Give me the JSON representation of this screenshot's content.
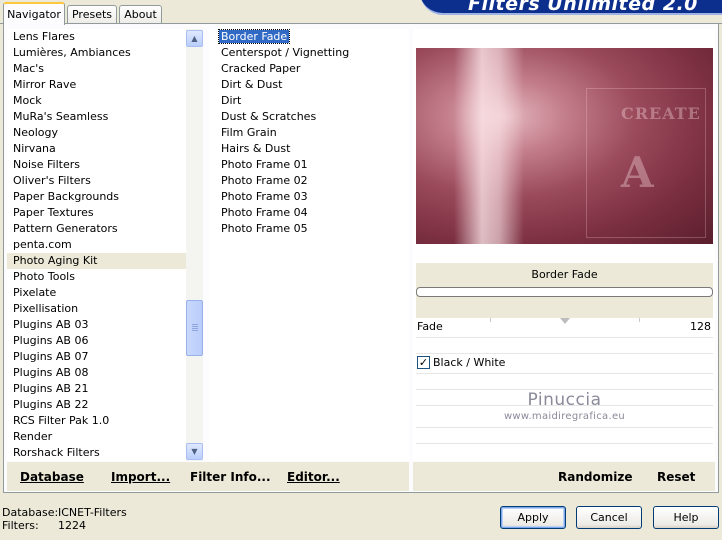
{
  "tabs": [
    {
      "label": "Navigator",
      "active": true
    },
    {
      "label": "Presets",
      "active": false
    },
    {
      "label": "About",
      "active": false
    }
  ],
  "app_title": "Filters Unlimited 2.0",
  "categories": [
    "Lens Flares",
    "Lumières, Ambiances",
    "Mac's",
    "Mirror Rave",
    "Mock",
    "MuRa's Seamless",
    "Neology",
    "Nirvana",
    "Noise Filters",
    "Oliver's Filters",
    "Paper Backgrounds",
    "Paper Textures",
    "Pattern Generators",
    "penta.com",
    "Photo Aging Kit",
    "Photo Tools",
    "Pixelate",
    "Pixellisation",
    "Plugins AB 03",
    "Plugins AB 06",
    "Plugins AB 07",
    "Plugins AB 08",
    "Plugins AB 21",
    "Plugins AB 22",
    "RCS Filter Pak 1.0",
    "Render",
    "Rorshack Filters"
  ],
  "selected_category": "Photo Aging Kit",
  "filters": [
    "Border Fade",
    "Centerspot / Vignetting",
    "Cracked Paper",
    "Dirt & Dust",
    "Dirt",
    "Dust & Scratches",
    "Film Grain",
    "Hairs & Dust",
    "Photo Frame 01",
    "Photo Frame 02",
    "Photo Frame 03",
    "Photo Frame 04",
    "Photo Frame 05"
  ],
  "selected_filter": "Border Fade",
  "preview": {
    "filter_name": "Border Fade",
    "progress": 0,
    "overlay_word": "CREATE",
    "overlay_letter": "A"
  },
  "params": {
    "fade_label": "Fade",
    "fade_value": "128",
    "black_white_label": "Black / White",
    "black_white_checked": true
  },
  "watermark": {
    "name": "Pinuccia",
    "url": "www.maidiregrafica.eu"
  },
  "toolbar": {
    "database": "Database",
    "import": "Import...",
    "filter_info": "Filter Info...",
    "editor": "Editor...",
    "randomize": "Randomize",
    "reset": "Reset"
  },
  "footer": {
    "database_label": "Database:",
    "database_value": "ICNET-Filters",
    "filters_label": "Filters:",
    "filters_value": "1224",
    "apply": "Apply",
    "cancel": "Cancel",
    "help": "Help"
  },
  "colors": {
    "selection": "#316AC5",
    "window_bg": "#ECE9D8",
    "banner": "#0C2E8C"
  }
}
